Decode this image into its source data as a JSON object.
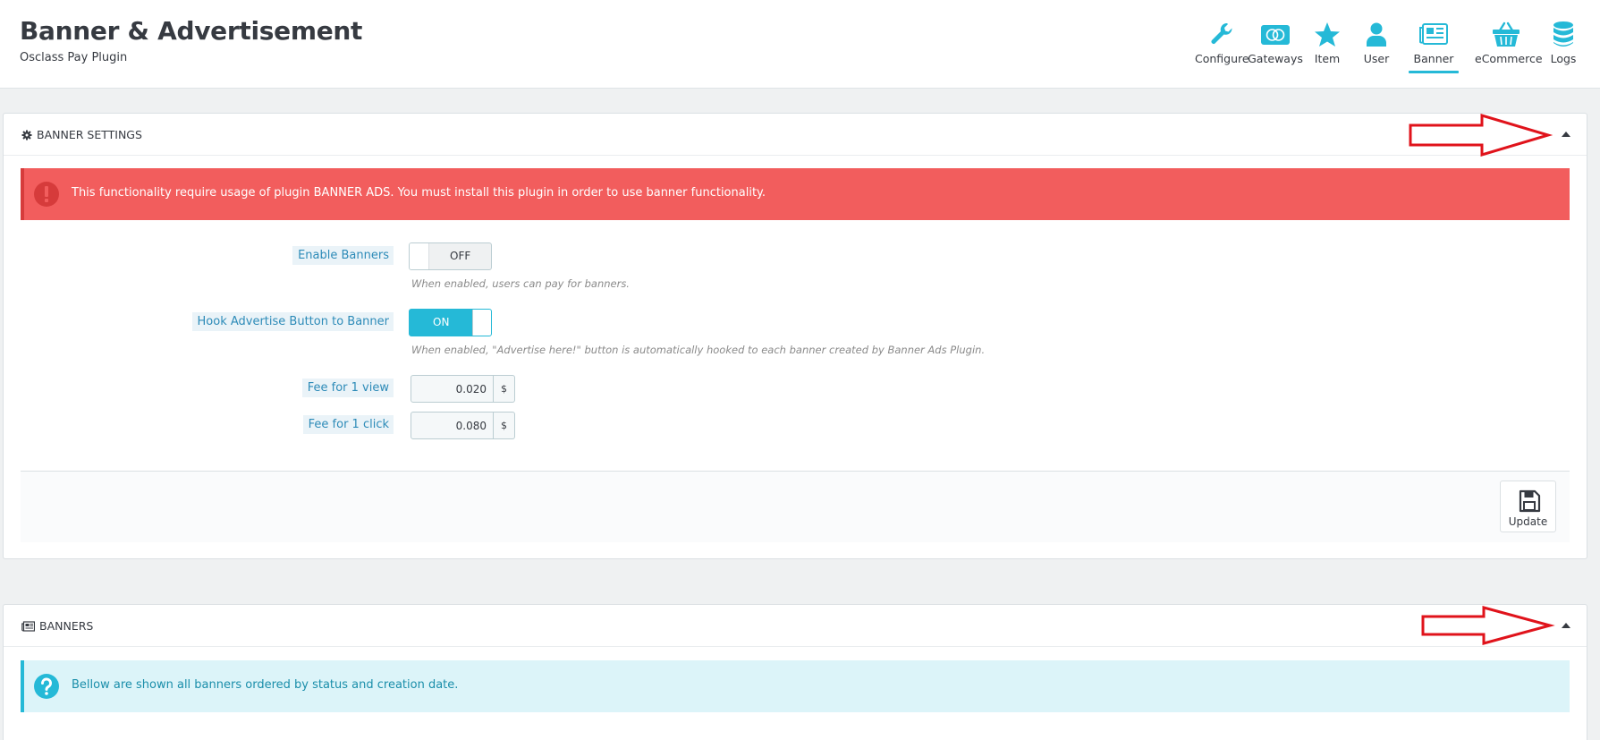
{
  "header": {
    "title": "Banner & Advertisement",
    "subtitle": "Osclass Pay Plugin",
    "nav": [
      {
        "label": "Configure",
        "icon": "wrench-icon",
        "active": false
      },
      {
        "label": "Gateways",
        "icon": "credit-card-icon",
        "active": false
      },
      {
        "label": "Item",
        "icon": "star-icon",
        "active": false
      },
      {
        "label": "User",
        "icon": "user-icon",
        "active": false
      },
      {
        "label": "Banner",
        "icon": "newspaper-icon",
        "active": true
      },
      {
        "label": "eCommerce",
        "icon": "basket-icon",
        "active": false
      },
      {
        "label": "Logs",
        "icon": "database-icon",
        "active": false
      }
    ]
  },
  "banner_settings": {
    "heading": "BANNER SETTINGS",
    "alert": "This functionality require usage of plugin BANNER ADS. You must install this plugin in order to use banner functionality.",
    "enable_banners": {
      "label": "Enable Banners",
      "state": "OFF",
      "help": "When enabled, users can pay for banners."
    },
    "hook_button": {
      "label": "Hook Advertise Button to Banner",
      "state": "ON",
      "help": "When enabled, \"Advertise here!\" button is automatically hooked to each banner created by Banner Ads Plugin."
    },
    "fee_view": {
      "label": "Fee for 1 view",
      "value": "0.020",
      "currency": "$"
    },
    "fee_click": {
      "label": "Fee for 1 click",
      "value": "0.080",
      "currency": "$"
    },
    "update_label": "Update"
  },
  "banners": {
    "heading": "BANNERS",
    "info": "Bellow are shown all banners ordered by status and creation date."
  },
  "colors": {
    "accent": "#25b9d7",
    "danger": "#f25d5d",
    "info_bg": "#dcf4f9",
    "annotation_arrow": "#e0131b"
  }
}
